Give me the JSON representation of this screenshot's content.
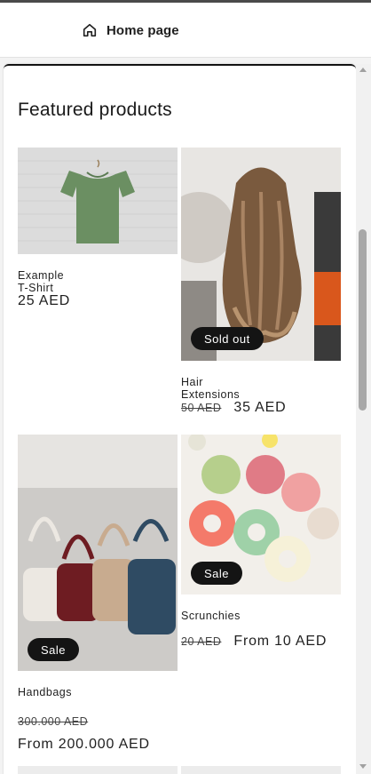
{
  "header": {
    "home_label": "Home page",
    "icon": "home-icon"
  },
  "section": {
    "title": "Featured products"
  },
  "products": [
    {
      "title": "Example T-Shirt",
      "price": "25 AED",
      "badge": "",
      "compare_price": ""
    },
    {
      "title": "Hair Extensions",
      "price": "35 AED",
      "badge": "Sold out",
      "compare_price": "50 AED"
    },
    {
      "title": "Handbags",
      "price": "From 200.000 AED",
      "badge": "Sale",
      "compare_price": "300.000 AED"
    },
    {
      "title": "Scrunchies",
      "price": "From 10 AED",
      "badge": "Sale",
      "compare_price": "20 AED"
    }
  ],
  "colors": {
    "badge_bg": "#141414",
    "text": "#121212",
    "background": "#ffffff"
  }
}
